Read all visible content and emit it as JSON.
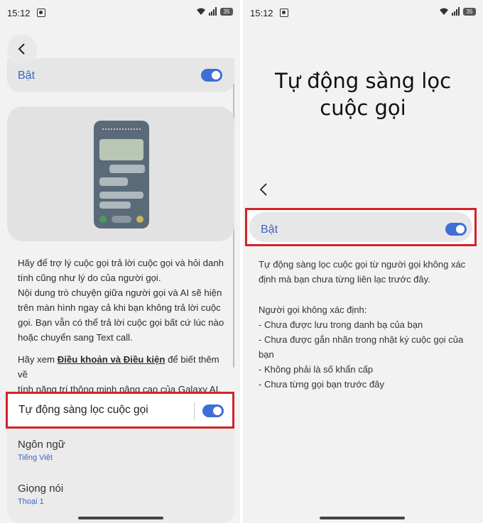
{
  "status": {
    "time": "15:12",
    "battery": "35"
  },
  "left": {
    "on_label": "Bật",
    "description_lines": [
      "Hãy để trợ lý cuộc gọi trả lời cuộc gọi và hỏi danh",
      "tính cũng như lý do của người gọi.",
      "Nội dung trò chuyện giữa người gọi và AI sẽ hiện",
      "trên màn hình ngay cả khi bạn không trả lời cuộc",
      "gọi. Bạn vẫn có thể trả lời cuộc gọi bất cứ lúc nào",
      "hoặc chuyển sang Text call."
    ],
    "terms": {
      "prefix": "Hãy xem ",
      "link": "Điều khoản và Điều kiện",
      "suffix": " để biết thêm về",
      "line2": "tính năng trí thông minh nâng cao của Galaxy AI."
    },
    "auto_screen_label": "Tự động sàng lọc cuộc gọi",
    "language": {
      "title": "Ngôn ngữ",
      "value": "Tiếng Việt"
    },
    "voice": {
      "title": "Giọng nói",
      "value": "Thoại 1"
    }
  },
  "right": {
    "title_line1": "Tự động sàng lọc",
    "title_line2": "cuộc gọi",
    "on_label": "Bật",
    "desc_lines": [
      "Tự động sàng lọc cuộc gọi từ người gọi không xác",
      "định mà bạn chưa từng liên lạc trước đây."
    ],
    "unknown_header": "Người gọi không xác định:",
    "list_lines": [
      "- Chưa được lưu trong danh bạ của bạn",
      "- Chưa được gắn nhãn trong nhật ký cuộc gọi của",
      "bạn",
      "- Không phải là số khẩn cấp",
      "- Chưa từng gọi bạn trước đây"
    ]
  },
  "colors": {
    "accent": "#3f6fd6",
    "highlight": "#d2232a"
  }
}
